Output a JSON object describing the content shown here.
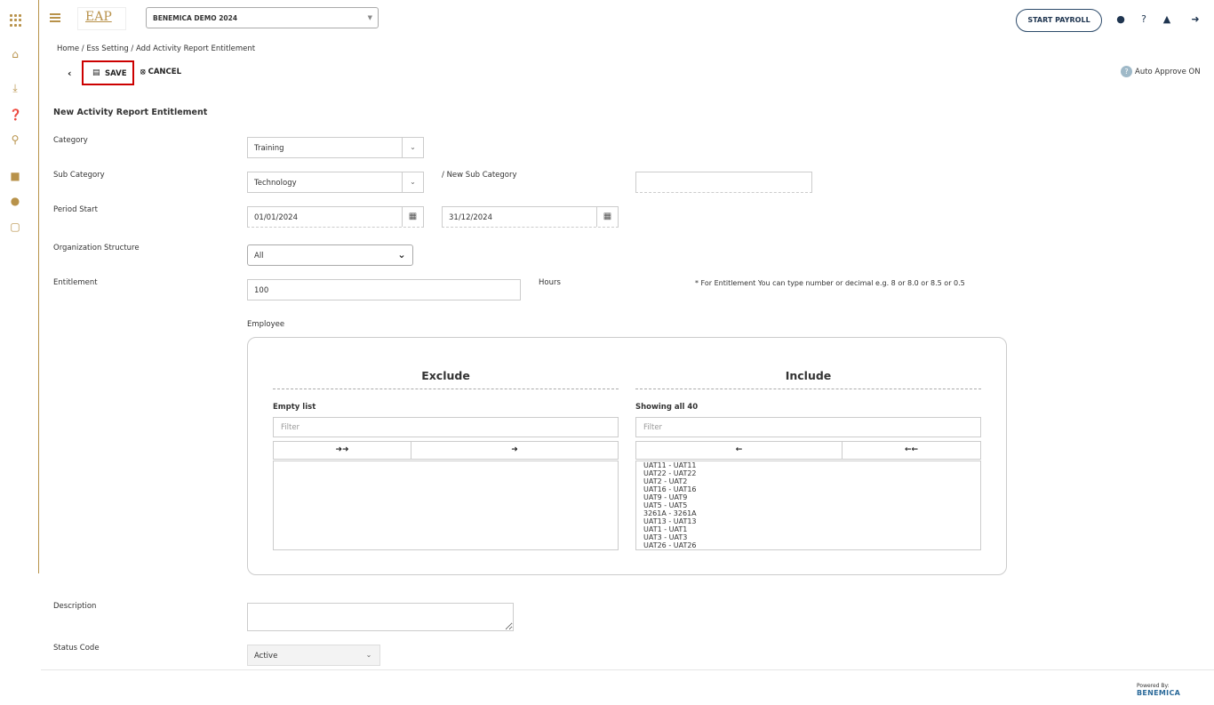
{
  "sidebar": {
    "icons": [
      "apps-grid-icon",
      "home-icon",
      "download-icon",
      "help-icon",
      "lightbulb-icon",
      "android-icon",
      "apple-icon",
      "document-icon"
    ]
  },
  "header": {
    "logo_text": "EAP",
    "company": "BENEMICA DEMO 2024",
    "start_payroll": "START PAYROLL"
  },
  "breadcrumb": "Home / Ess Setting / Add Activity Report Entitlement",
  "toolbar": {
    "save_label": "SAVE",
    "cancel_label": "CANCEL",
    "auto_approve": "Auto Approve ON"
  },
  "form": {
    "title": "New Activity Report Entitlement",
    "category_label": "Category",
    "category_value": "Training",
    "subcategory_label": "Sub Category",
    "subcategory_value": "Technology",
    "new_subcategory_label": "/ New Sub Category",
    "new_subcategory_value": "",
    "period_label": "Period Start",
    "period_start": "01/01/2024",
    "period_end": "31/12/2024",
    "org_label": "Organization Structure",
    "org_value": "All",
    "entitlement_label": "Entitlement",
    "entitlement_value": "100",
    "hours_label": "Hours",
    "entitlement_note": "* For Entitlement You can type number or decimal e.g. 8 or 8.0 or 8.5 or 0.5",
    "employee_label": "Employee",
    "description_label": "Description",
    "status_label": "Status Code",
    "status_value": "Active"
  },
  "dual_list": {
    "exclude_title": "Exclude",
    "include_title": "Include",
    "exclude_info": "Empty list",
    "include_info": "Showing all 40",
    "filter_placeholder": "Filter",
    "include_items": [
      "UAT11 - UAT11",
      "UAT22 - UAT22",
      "UAT2 - UAT2",
      "UAT16 - UAT16",
      "UAT9 - UAT9",
      "UAT5 - UAT5",
      "3261A - 3261A",
      "UAT13 - UAT13",
      "UAT1 - UAT1",
      "UAT3 - UAT3",
      "UAT26 - UAT26"
    ]
  },
  "footer": {
    "powered_by": "Powered By:",
    "brand": "BENEMICA"
  }
}
